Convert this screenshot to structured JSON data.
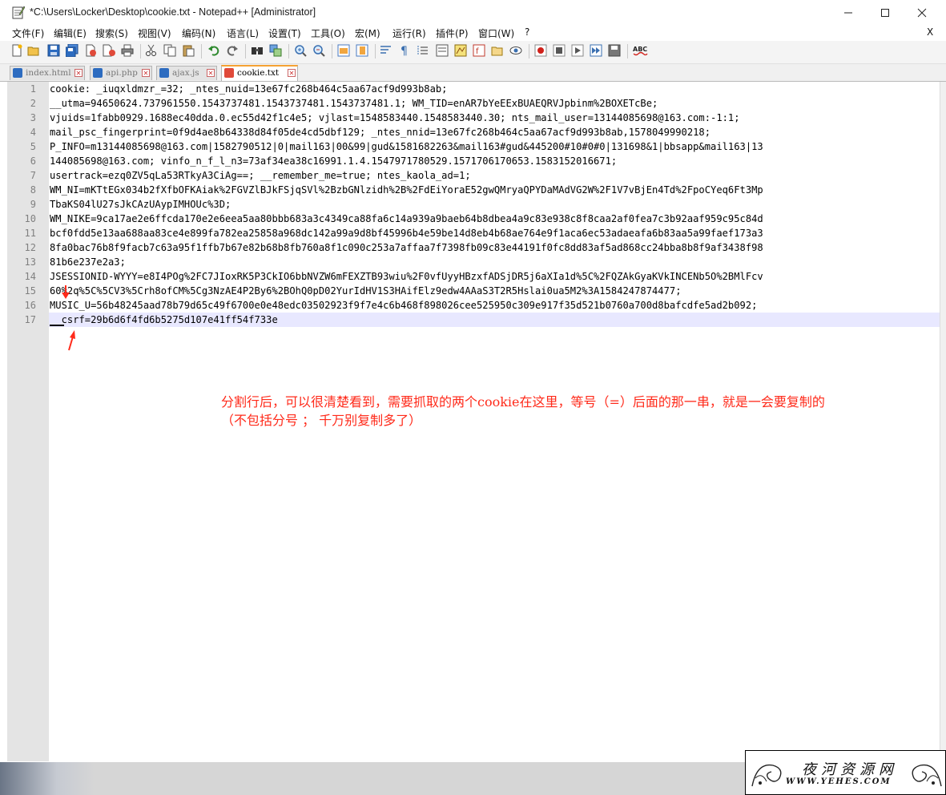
{
  "window": {
    "title": "*C:\\Users\\Locker\\Desktop\\cookie.txt - Notepad++ [Administrator]",
    "close_doc_label": "X"
  },
  "menu": {
    "items": [
      "文件(F)",
      "编辑(E)",
      "搜索(S)",
      "视图(V)",
      "编码(N)",
      "语言(L)",
      "设置(T)",
      "工具(O)",
      "宏(M)",
      "运行(R)",
      "插件(P)",
      "窗口(W)",
      "?"
    ]
  },
  "tabs": [
    {
      "label": "index.html",
      "active": false
    },
    {
      "label": "api.php",
      "active": false
    },
    {
      "label": "ajax.js",
      "active": false
    },
    {
      "label": "cookie.txt",
      "active": true
    }
  ],
  "toolbar": {
    "spellcheck_label": "ABC"
  },
  "editor": {
    "line_numbers": [
      "1",
      "2",
      "3",
      "4",
      "5",
      "6",
      "7",
      "8",
      "9",
      "10",
      "11",
      "12",
      "13",
      "14",
      "15",
      "16",
      "17"
    ],
    "rows": [
      "cookie: _iuqxldmzr_=32; _ntes_nuid=13e67fc268b464c5aa67acf9d993b8ab;",
      "__utma=94650624.737961550.1543737481.1543737481.1543737481.1; WM_TID=enAR7bYeEExBUAEQRVJpbinm%2BOXETcBe;",
      "vjuids=1fabb0929.1688ec40dda.0.ec55d42f1c4e5; vjlast=1548583440.1548583440.30; nts_mail_user=13144085698@163.com:-1:1;",
      "mail_psc_fingerprint=0f9d4ae8b64338d84f05de4cd5dbf129; _ntes_nnid=13e67fc268b464c5aa67acf9d993b8ab,1578049990218;",
      "P_INFO=m13144085698@163.com|1582790512|0|mail163|00&99|gud&1581682263&mail163#gud&445200#10#0#0|131698&1|bbsapp&mail163|13",
      "144085698@163.com; vinfo_n_f_l_n3=73af34ea38c16991.1.4.1547971780529.1571706170653.1583152016671;",
      "usertrack=ezq0ZV5qLa53RTkyA3CiAg==; __remember_me=true; ntes_kaola_ad=1;",
      "WM_NI=mKTtEGx034b2fXfbOFKAiak%2FGVZlBJkFSjqSVl%2BzbGNlzidh%2B%2FdEiYoraE52gwQMryaQPYDaMAdVG2W%2F1V7vBjEn4Td%2FpoCYeq6Ft3Mp",
      "TbaKS04lU27sJkCAzUAypIMHOUc%3D;",
      "WM_NIKE=9ca17ae2e6ffcda170e2e6eea5aa80bbb683a3c4349ca88fa6c14a939a9baeb64b8dbea4a9c83e938c8f8caa2af0fea7c3b92aaf959c95c84d",
      "bcf0fdd5e13aa688aa83ce4e899fa782ea25858a968dc142a99a9d8bf45996b4e59be14d8eb4b68ae764e9f1aca6ec53adaeafa6b83aa5a99faef173a3",
      "8fa0bac76b8f9facb7c63a95f1ffb7b67e82b68b8fb760a8f1c090c253a7affaa7f7398fb09c83e44191f0fc8dd83af5ad868cc24bba8b8f9af3438f98",
      "81b6e237e2a3;",
      "JSESSIONID-WYYY=e8I4POg%2FC7JIoxRK5P3CkIO6bbNVZW6mFEXZTB93wiu%2F0vfUyyHBzxfADSjDR5j6aXIa1d%5C%2FQZAkGyaKVkINCENb5O%2BMlFcv",
      "60%2q%5C%5CV3%5Crh8ofCM%5Cg3NzAE4P2By6%2BOhQ0pD02YurIdHV1S3HAifElz9edw4AAaS3T2R5Hslai0ua5M2%3A1584247874477;",
      "MUSIC_U=56b48245aad78b79d65c49f6700e0e48edc03502923f9f7e4c6b468f898026cee525950c309e917f35d521b0760a700d8bafcdfe5ad2b092;",
      "__csrf=29b6d6f4fd6b5275d107e41ff54f733e"
    ]
  },
  "annotation": {
    "line1": "分割行后，可以很清楚看到，需要抓取的两个cookie在这里，等号（=）后面的那一串，就是一会要复制的",
    "line2": "（不包括分号 ；  千万别复制多了）"
  },
  "watermark": {
    "title": "夜河资源网",
    "url": "WWW.YEHES.COM"
  },
  "colors": {
    "annotation": "#ff2a1a",
    "tab_active_accent": "#f5a234",
    "gutter": "#e4e4e4",
    "current_line": "#e8e8ff"
  }
}
